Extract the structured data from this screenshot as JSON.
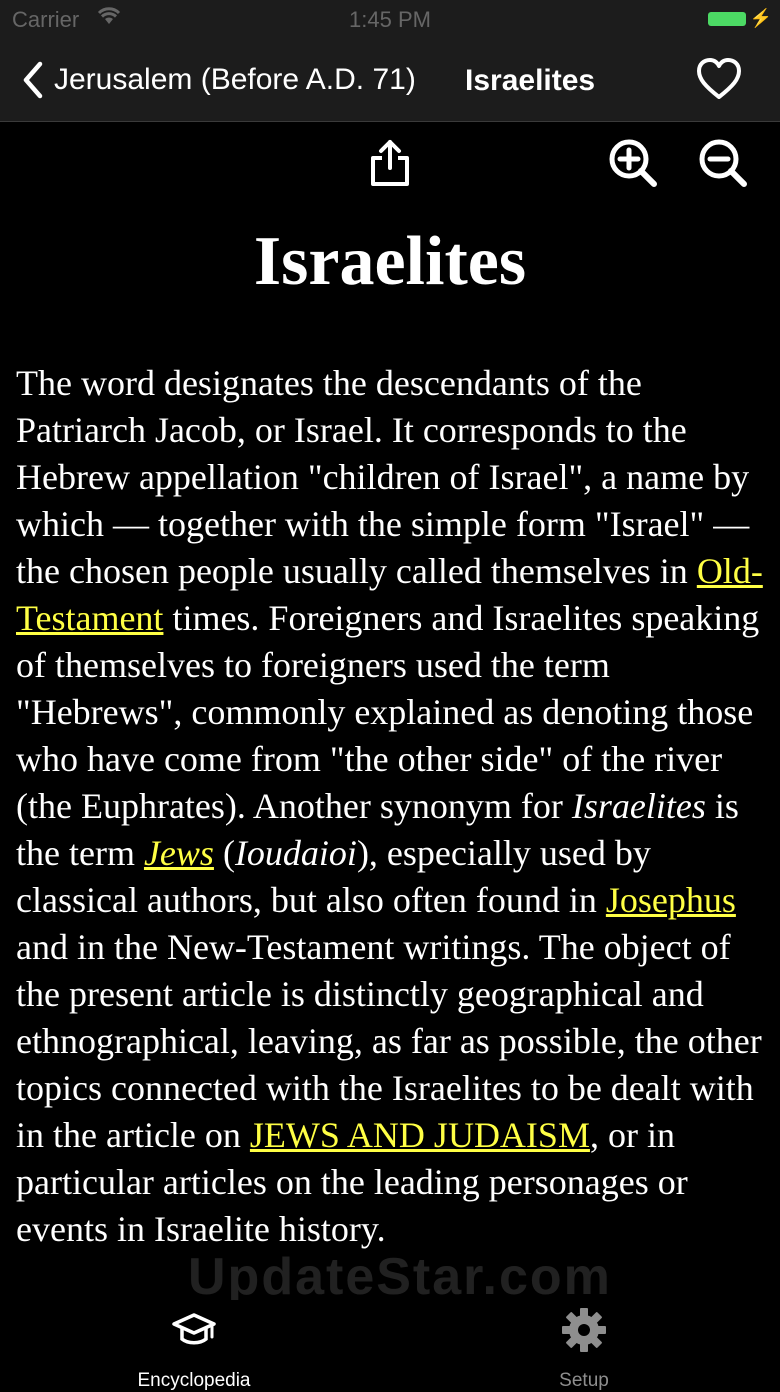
{
  "status": {
    "carrier": "Carrier",
    "time": "1:45 PM",
    "battery_color": "#4cd964"
  },
  "nav": {
    "back_label": "Jerusalem (Before A.D. 71)",
    "title": "Israelites"
  },
  "toolbar": {
    "icons": [
      "share-icon",
      "zoom-in-icon",
      "zoom-out-icon"
    ]
  },
  "article": {
    "title": "Israelites",
    "p1": "The word designates the descendants of the Patriarch Jacob, or Israel. It corresponds to the Hebrew appellation \"children of Israel\", a name by which — together with the simple form \"Israel\" — the chosen people usually called themselves in ",
    "link_old_testament": "Old-Testament",
    "p2": " times. Foreigners and Israelites speaking of themselves to foreigners used the term \"Hebrews\", commonly explained as denoting those who have come from \"the other side\" of the river (the Euphrates). Another synonym for ",
    "em_israelites": "Israelites",
    "p3": " is the term ",
    "link_jews": "Jews",
    "p4": " (",
    "em_ioudaioi": "Ioudaioi",
    "p5": "), especially used by classical authors, but also often found in ",
    "link_josephus": "Josephus",
    "p6": " and in the New-Testament writings. The object of the present article is distinctly geographical and ethnographical, leaving, as far as possible, the other topics connected with the Israelites to be dealt with in the article on ",
    "link_jews_judaism": "JEWS AND JUDAISM",
    "p7": ", or in particular articles on the leading personages or events in Israelite history.",
    "link_color": "#ffff44"
  },
  "watermark": "UpdateStar.com",
  "tabs": [
    {
      "label": "Encyclopedia",
      "icon": "graduation-cap-icon",
      "active": true
    },
    {
      "label": "Setup",
      "icon": "gear-icon",
      "active": false
    }
  ]
}
